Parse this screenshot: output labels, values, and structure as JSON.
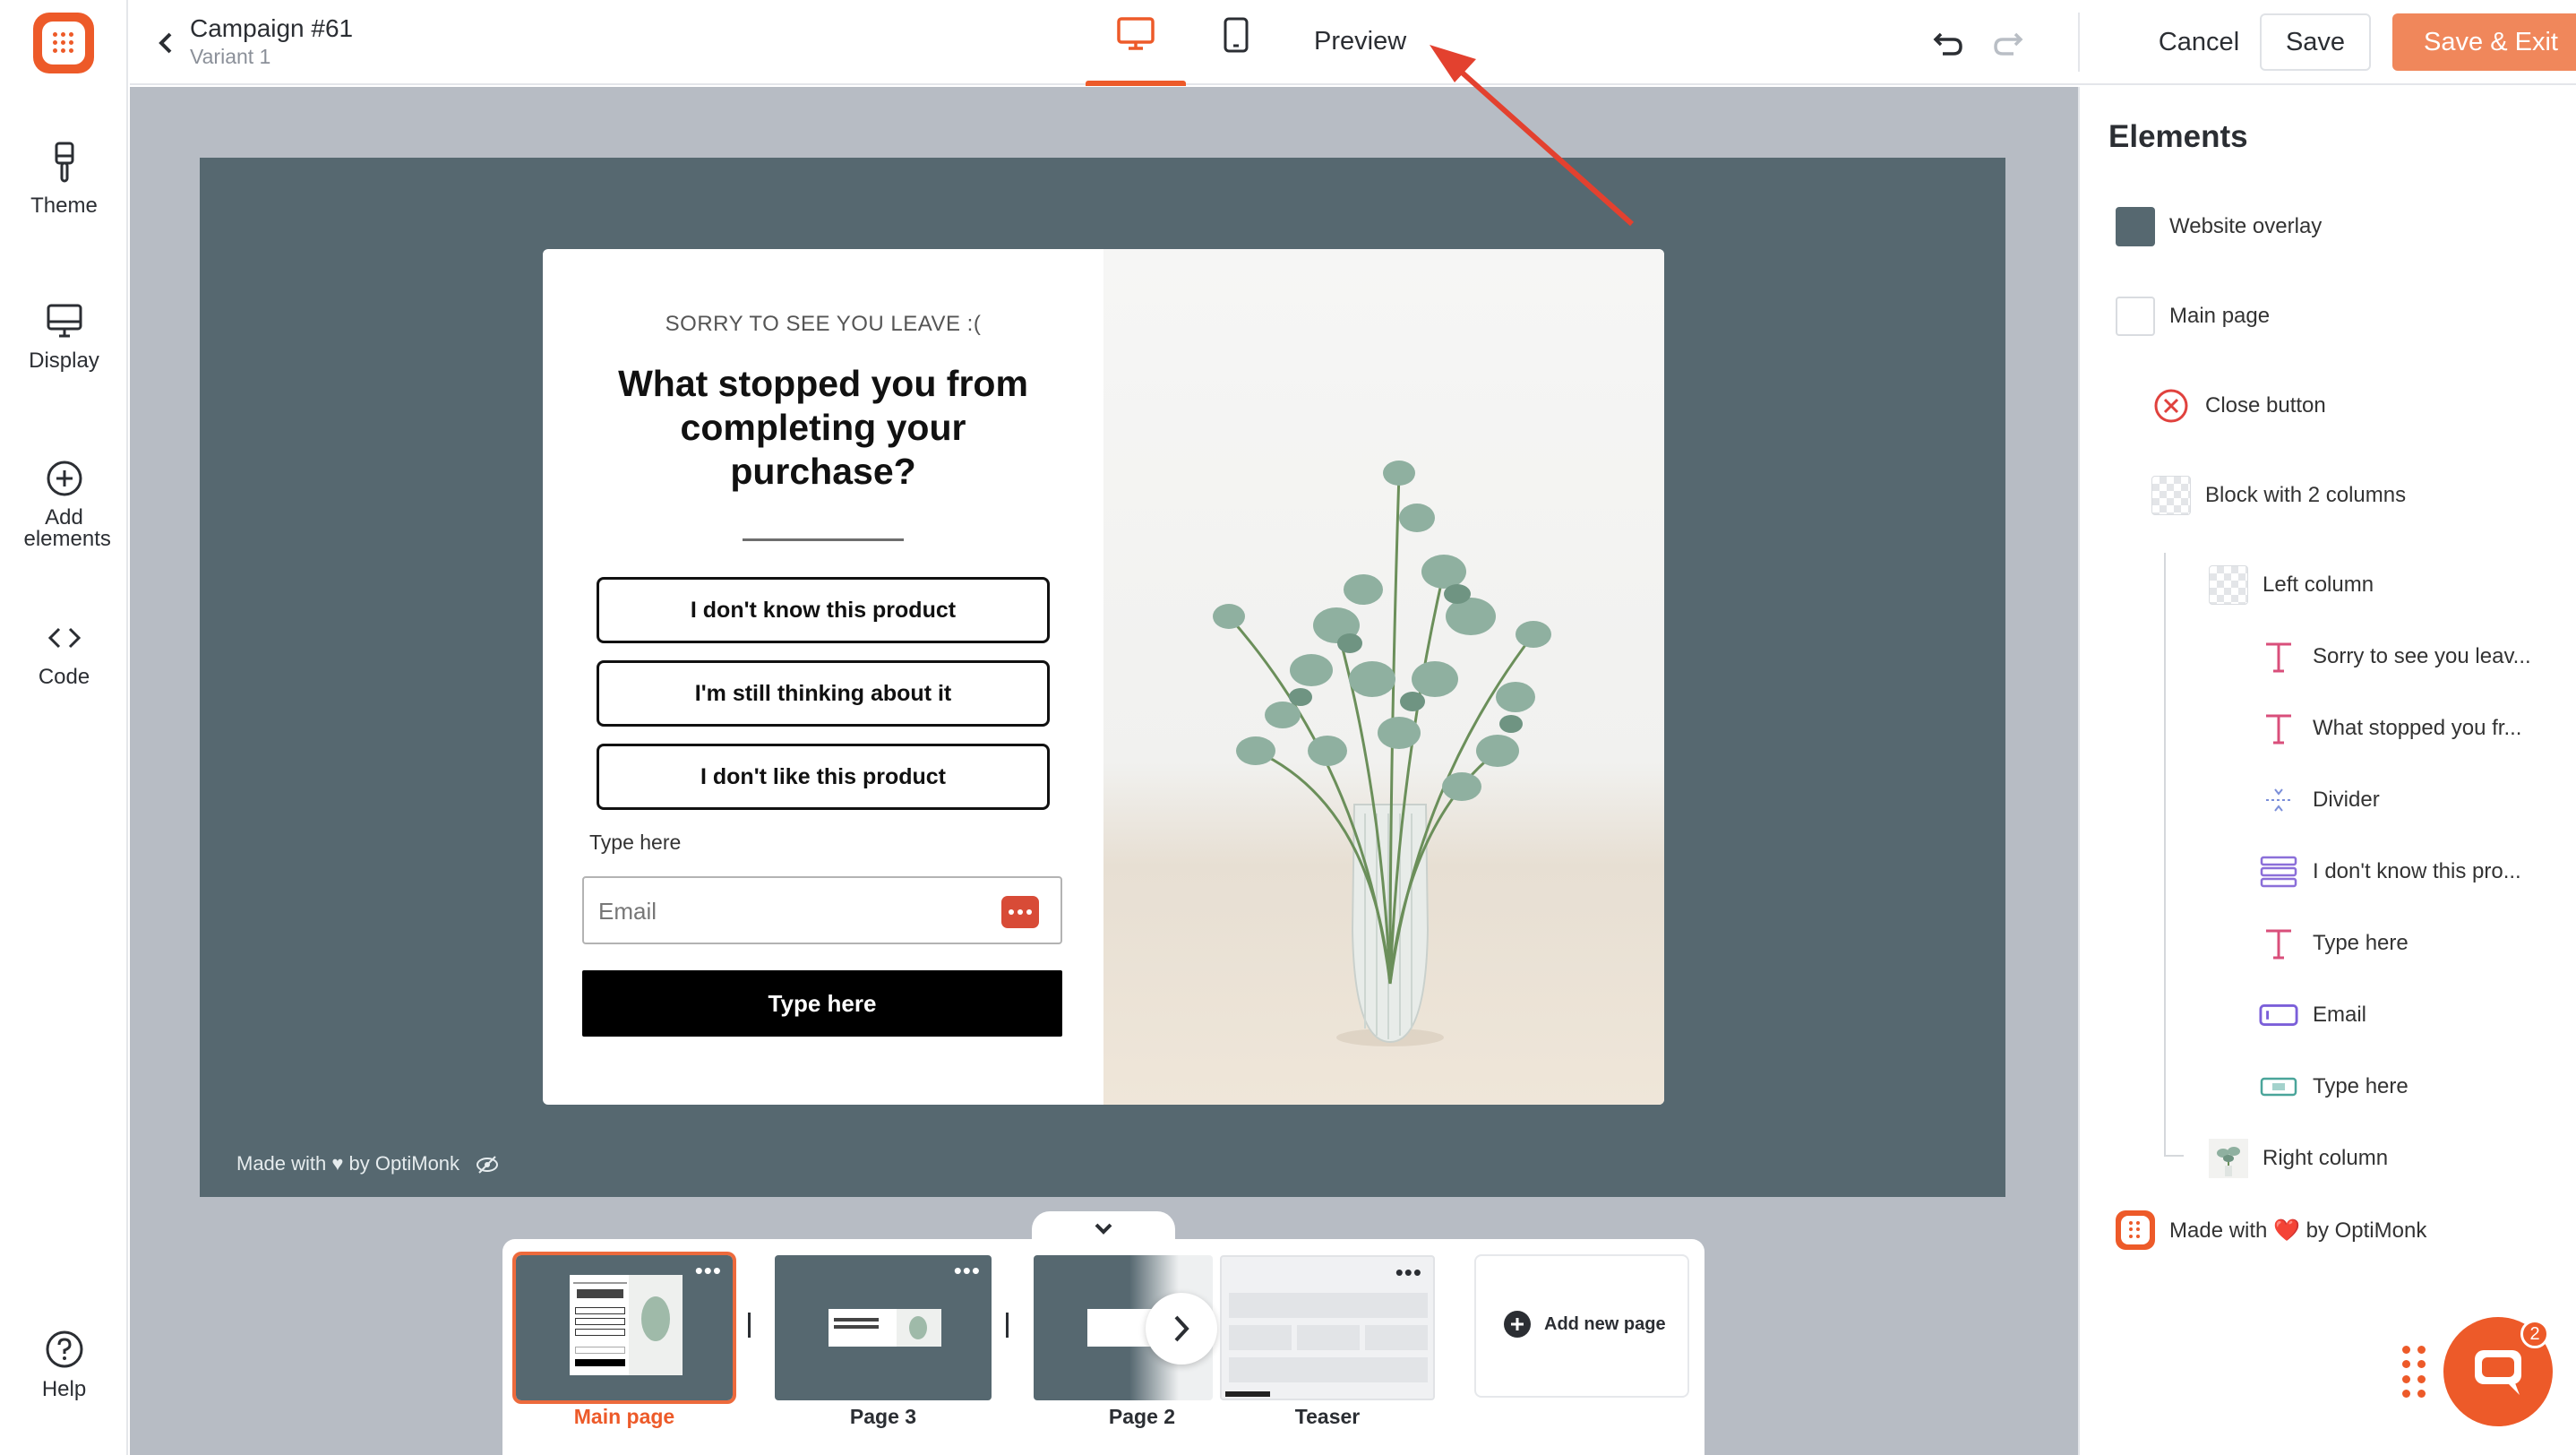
{
  "sidebar": {
    "items": [
      {
        "label": "Theme",
        "icon": "brush-icon"
      },
      {
        "label": "Display",
        "icon": "monitor-icon"
      },
      {
        "label": "Add elements",
        "icon": "plus-circle-icon"
      },
      {
        "label": "Code",
        "icon": "code-icon"
      }
    ],
    "help": {
      "label": "Help",
      "icon": "question-circle-icon"
    }
  },
  "topbar": {
    "title": "Campaign #61",
    "subtitle": "Variant 1",
    "preview_label": "Preview",
    "cancel_label": "Cancel",
    "save_label": "Save",
    "save_exit_label": "Save & Exit",
    "active_device": "desktop"
  },
  "popup": {
    "eyebrow": "SORRY TO SEE YOU LEAVE :(",
    "headline": "What stopped you from completing your purchase?",
    "options": [
      "I don't know this product",
      "I'm still thinking about it",
      "I don't like this product"
    ],
    "input_label": "Type here",
    "email_placeholder": "Email",
    "submit_label": "Type here",
    "made_with": "Made with ♥ by OptiMonk"
  },
  "pages": [
    {
      "label": "Main page",
      "active": true
    },
    {
      "label": "Page 3",
      "active": false
    },
    {
      "label": "Page 2",
      "active": false
    },
    {
      "label": "Teaser",
      "active": false
    }
  ],
  "add_page_label": "Add new page",
  "elements_panel": {
    "title": "Elements",
    "items": [
      {
        "label": "Website overlay",
        "icon": "swatch-icon"
      },
      {
        "label": "Main page",
        "icon": "blank-swatch-icon"
      },
      {
        "label": "Close button",
        "icon": "close-circle-icon"
      },
      {
        "label": "Block with 2 columns",
        "icon": "checker-icon"
      },
      {
        "label": "Left column",
        "icon": "checker-icon"
      },
      {
        "label": "Sorry to see you leav...",
        "icon": "text-icon"
      },
      {
        "label": "What stopped you fr...",
        "icon": "text-icon"
      },
      {
        "label": "Divider",
        "icon": "divider-icon"
      },
      {
        "label": "I don't know this pro...",
        "icon": "list-icon"
      },
      {
        "label": "Type here",
        "icon": "text-icon"
      },
      {
        "label": "Email",
        "icon": "input-icon"
      },
      {
        "label": "Type here",
        "icon": "button-icon"
      },
      {
        "label": "Right column",
        "icon": "image-icon"
      },
      {
        "label": "Made with ❤️ by OptiMonk",
        "icon": "optimonk-logo-icon"
      }
    ]
  },
  "chat": {
    "badge_count": "2"
  },
  "colors": {
    "accent": "#ed5a29",
    "overlay": "#566870",
    "canvas_bg": "#b7bcc4"
  }
}
